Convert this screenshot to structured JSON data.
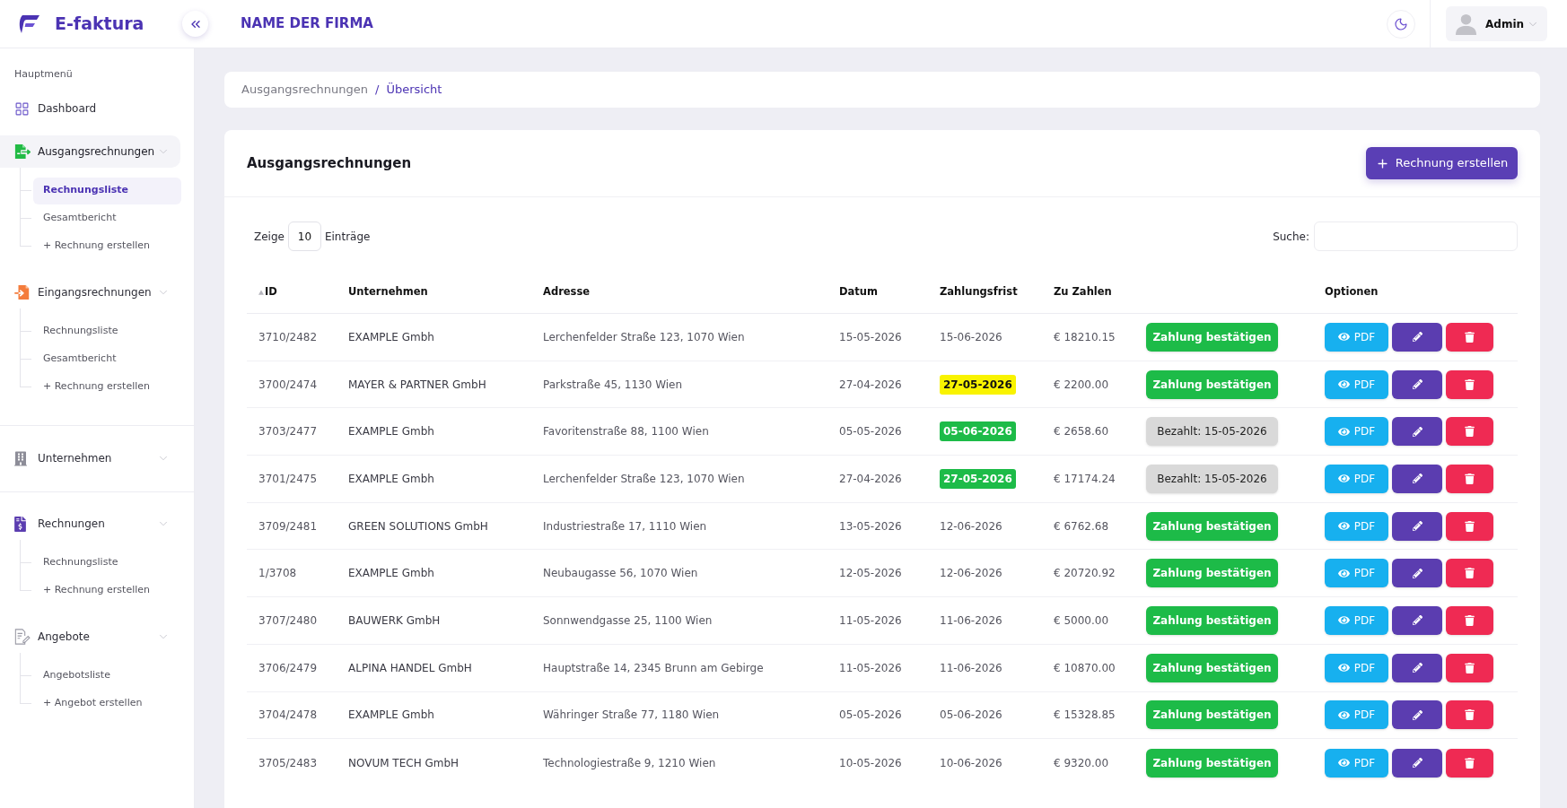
{
  "app": {
    "logo": "E-faktura",
    "company": "NAME DER FIRMA",
    "user": "Admin"
  },
  "sidebar": {
    "sections": [
      {
        "heading": "Hauptmenü",
        "items": [
          {
            "label": "Dashboard",
            "kind": "link",
            "selected": false
          },
          {
            "label": "Ausgangsrechnungen",
            "kind": "group",
            "selected": true,
            "children": [
              {
                "label": "Rechnungsliste",
                "selected": true
              },
              {
                "label": "Gesamtbericht",
                "selected": false
              },
              {
                "label": "+ Rechnung erstellen",
                "selected": false
              }
            ]
          },
          {
            "label": "Eingangsrechnungen",
            "kind": "group",
            "selected": false,
            "children": [
              {
                "label": "Rechnungsliste",
                "selected": false
              },
              {
                "label": "Gesamtbericht",
                "selected": false
              },
              {
                "label": "+ Rechnung erstellen",
                "selected": false
              }
            ]
          }
        ]
      },
      {
        "items": [
          {
            "label": "Unternehmen",
            "kind": "group",
            "selected": false
          }
        ]
      },
      {
        "items": [
          {
            "label": "Rechnungen",
            "kind": "group",
            "selected": false,
            "children": [
              {
                "label": "Rechnungsliste",
                "selected": false
              },
              {
                "label": "+ Rechnung erstellen",
                "selected": false
              }
            ]
          },
          {
            "label": "Angebote",
            "kind": "group",
            "selected": false,
            "children": [
              {
                "label": "Angebotsliste",
                "selected": false
              },
              {
                "label": "+ Angebot erstellen",
                "selected": false
              }
            ]
          }
        ]
      }
    ]
  },
  "breadcrumb": {
    "items": [
      {
        "label": "Ausgangsrechnungen",
        "current": false
      },
      {
        "label": "Übersicht",
        "current": true
      }
    ],
    "separator": "/"
  },
  "card": {
    "title": "Ausgangsrechnungen",
    "create_button": "Rechnung erstellen"
  },
  "length_control": {
    "before": "Zeige",
    "value": "10",
    "after": "Einträge"
  },
  "search": {
    "label": "Suche:"
  },
  "table": {
    "columns": [
      {
        "label": "ID",
        "sorted": true
      },
      {
        "label": "Unternehmen",
        "sorted": false
      },
      {
        "label": "Adresse",
        "sorted": false
      },
      {
        "label": "Datum",
        "sorted": false
      },
      {
        "label": "Zahlungsfrist",
        "sorted": false
      },
      {
        "label": "Zu Zahlen",
        "sorted": false
      },
      {
        "label": "Optionen",
        "sorted": false
      }
    ],
    "rows": [
      {
        "id": "3710/2482",
        "company": "EXAMPLE Gmbh",
        "address": "Lerchenfelder Straße 123, 1070 Wien",
        "date": "15-05-2026",
        "due": {
          "text": "15-06-2026",
          "kind": "plain"
        },
        "amount": "€ 18210.15",
        "payment": {
          "kind": "confirm",
          "label": "Zahlung bestätigen"
        },
        "pdf_button": "PDF"
      },
      {
        "id": "3700/2474",
        "company": "MAYER & PARTNER GmbH",
        "address": "Parkstraße 45, 1130 Wien",
        "date": "27-04-2026",
        "due": {
          "text": "27-05-2026",
          "kind": "warning"
        },
        "amount": "€ 2200.00",
        "payment": {
          "kind": "confirm",
          "label": "Zahlung bestätigen"
        },
        "pdf_button": "PDF"
      },
      {
        "id": "3703/2477",
        "company": "EXAMPLE Gmbh",
        "address": "Favoritenstraße 88, 1100 Wien",
        "date": "05-05-2026",
        "due": {
          "text": "05-06-2026",
          "kind": "paid"
        },
        "amount": "€ 2658.60",
        "payment": {
          "kind": "paid",
          "label": "Bezahlt: 15-05-2026"
        },
        "pdf_button": "PDF"
      },
      {
        "id": "3701/2475",
        "company": "EXAMPLE Gmbh",
        "address": "Lerchenfelder Straße 123, 1070 Wien",
        "date": "27-04-2026",
        "due": {
          "text": "27-05-2026",
          "kind": "paid"
        },
        "amount": "€ 17174.24",
        "payment": {
          "kind": "paid",
          "label": "Bezahlt: 15-05-2026"
        },
        "pdf_button": "PDF"
      },
      {
        "id": "3709/2481",
        "company": "GREEN SOLUTIONS GmbH",
        "address": "Industriestraße 17, 1110 Wien",
        "date": "13-05-2026",
        "due": {
          "text": "12-06-2026",
          "kind": "plain"
        },
        "amount": "€ 6762.68",
        "payment": {
          "kind": "confirm",
          "label": "Zahlung bestätigen"
        },
        "pdf_button": "PDF"
      },
      {
        "id": "1/3708",
        "company": "EXAMPLE Gmbh",
        "address": "Neubaugasse 56, 1070 Wien",
        "date": "12-05-2026",
        "due": {
          "text": "12-06-2026",
          "kind": "plain"
        },
        "amount": "€ 20720.92",
        "payment": {
          "kind": "confirm",
          "label": "Zahlung bestätigen"
        },
        "pdf_button": "PDF"
      },
      {
        "id": "3707/2480",
        "company": "BAUWERK GmbH",
        "address": "Sonnwendgasse 25, 1100 Wien",
        "date": "11-05-2026",
        "due": {
          "text": "11-06-2026",
          "kind": "plain"
        },
        "amount": "€ 5000.00",
        "payment": {
          "kind": "confirm",
          "label": "Zahlung bestätigen"
        },
        "pdf_button": "PDF"
      },
      {
        "id": "3706/2479",
        "company": "ALPINA HANDEL GmbH",
        "address": "Hauptstraße 14, 2345 Brunn am Gebirge",
        "date": "11-05-2026",
        "due": {
          "text": "11-06-2026",
          "kind": "plain"
        },
        "amount": "€ 10870.00",
        "payment": {
          "kind": "confirm",
          "label": "Zahlung bestätigen"
        },
        "pdf_button": "PDF"
      },
      {
        "id": "3704/2478",
        "company": "EXAMPLE Gmbh",
        "address": "Währinger Straße 77, 1180 Wien",
        "date": "05-05-2026",
        "due": {
          "text": "05-06-2026",
          "kind": "plain"
        },
        "amount": "€ 15328.85",
        "payment": {
          "kind": "confirm",
          "label": "Zahlung bestätigen"
        },
        "pdf_button": "PDF"
      },
      {
        "id": "3705/2483",
        "company": "NOVUM TECH GmbH",
        "address": "Technologiestraße 9, 1210 Wien",
        "date": "10-05-2026",
        "due": {
          "text": "10-06-2026",
          "kind": "plain"
        },
        "amount": "€ 9320.00",
        "payment": {
          "kind": "confirm",
          "label": "Zahlung bestätigen"
        },
        "pdf_button": "PDF"
      }
    ]
  }
}
